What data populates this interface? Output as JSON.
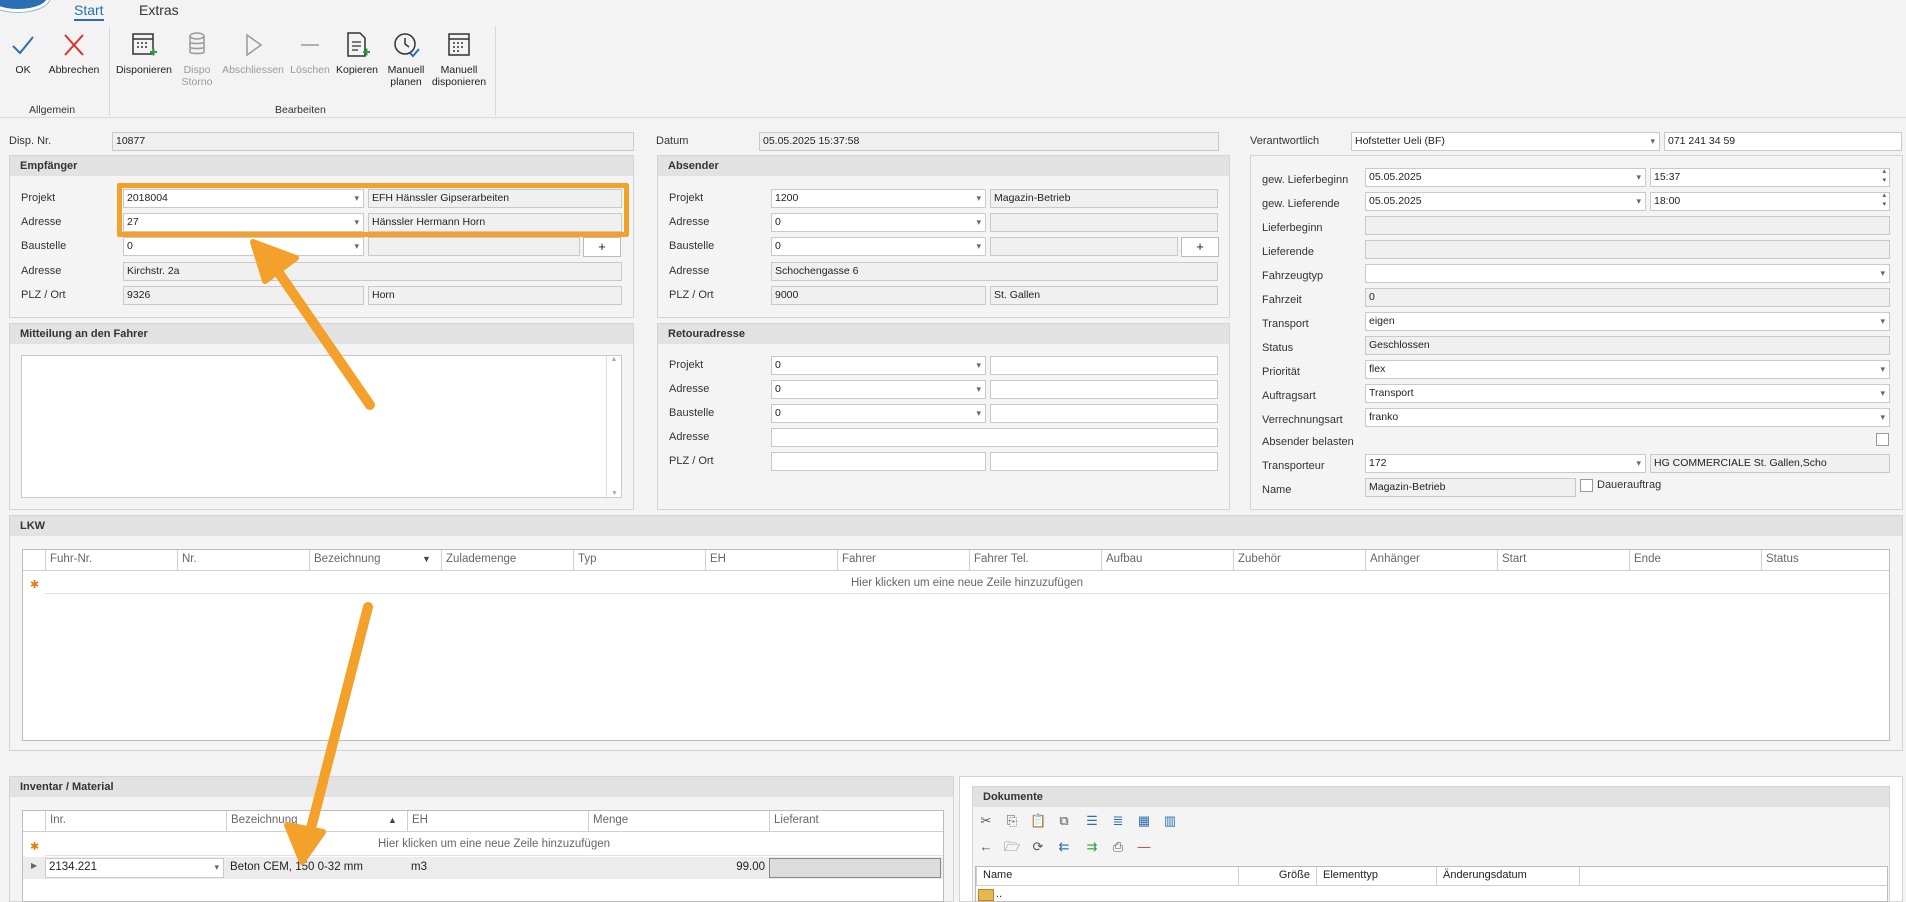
{
  "tabs": [
    "Start",
    "Extras"
  ],
  "ribbon": {
    "ok": "OK",
    "cancel": "Abbrechen",
    "group_general": "Allgemein",
    "disponieren": "Disponieren",
    "dispo_storno_1": "Dispo",
    "dispo_storno_2": "Storno",
    "abschliessen": "Abschliessen",
    "loeschen": "Löschen",
    "kopieren": "Kopieren",
    "manuell_planen_1": "Manuell",
    "manuell_planen_2": "planen",
    "manuell_disp_1": "Manuell",
    "manuell_disp_2": "disponieren",
    "group_edit": "Bearbeiten"
  },
  "header": {
    "disp_nr_label": "Disp. Nr.",
    "disp_nr": "10877",
    "datum_label": "Datum",
    "datum": "05.05.2025 15:37:58",
    "verantwortlich_label": "Verantwortlich",
    "verantwortlich": "Hofstetter Ueli (BF)",
    "phone": "071 241 34 59"
  },
  "empfaenger": {
    "title": "Empfänger",
    "projekt_label": "Projekt",
    "projekt": "2018004",
    "projekt_name": "EFH Hänssler Gipserarbeiten",
    "adresse_label": "Adresse",
    "adresse": "27",
    "adresse_name": "Hänssler Hermann Horn",
    "baustelle_label": "Baustelle",
    "baustelle": "0",
    "plus": "+",
    "strasse_label": "Adresse",
    "strasse": "Kirchstr. 2a",
    "plz_label": "PLZ / Ort",
    "plz": "9326",
    "ort": "Horn"
  },
  "absender": {
    "title": "Absender",
    "projekt_label": "Projekt",
    "projekt": "1200",
    "projekt_name": "Magazin-Betrieb",
    "adresse_label": "Adresse",
    "adresse": "0",
    "baustelle_label": "Baustelle",
    "baustelle": "0",
    "plus": "+",
    "strasse_label": "Adresse",
    "strasse": "Schochengasse 6",
    "plz_label": "PLZ / Ort",
    "plz": "9000",
    "ort": "St. Gallen"
  },
  "mitteilung": {
    "title": "Mitteilung an den Fahrer"
  },
  "retour": {
    "title": "Retouradresse",
    "projekt_label": "Projekt",
    "projekt": "0",
    "adresse_label": "Adresse",
    "adresse": "0",
    "baustelle_label": "Baustelle",
    "baustelle": "0",
    "strasse_label": "Adresse",
    "plz_label": "PLZ / Ort"
  },
  "right": {
    "lieferbeginn_label": "gew. Lieferbeginn",
    "lieferbeginn_date": "05.05.2025",
    "lieferbeginn_time": "15:37",
    "lieferende_label": "gew. Lieferende",
    "lieferende_date": "05.05.2025",
    "lieferende_time": "18:00",
    "lb_label": "Lieferbeginn",
    "le_label": "Lieferende",
    "fahrzeugtyp_label": "Fahrzeugtyp",
    "fahrzeit_label": "Fahrzeit",
    "fahrzeit": "0",
    "transport_label": "Transport",
    "transport": "eigen",
    "status_label": "Status",
    "status": "Geschlossen",
    "prioritaet_label": "Priorität",
    "prioritaet": "flex",
    "auftragsart_label": "Auftragsart",
    "auftragsart": "Transport",
    "verrechnung_label": "Verrechnungsart",
    "verrechnung": "franko",
    "absender_belasten_label": "Absender belasten",
    "transporteur_label": "Transporteur",
    "transporteur": "172",
    "transporteur_name": "HG COMMERCIALE St. Gallen,Scho",
    "name_label": "Name",
    "name": "Magazin-Betrieb",
    "dauerauftrag_label": "Dauerauftrag"
  },
  "lkw": {
    "title": "LKW",
    "columns": [
      "Fuhr-Nr.",
      "Nr.",
      "Bezeichnung",
      "Zulademenge",
      "Typ",
      "EH",
      "Fahrer",
      "Fahrer Tel.",
      "Aufbau",
      "Zubehör",
      "Anhänger",
      "Start",
      "Ende",
      "Status"
    ],
    "new_row": "Hier klicken um eine neue Zeile hinzuzufügen"
  },
  "inventar": {
    "title": "Inventar / Material",
    "columns": [
      "Inr.",
      "Bezeichnung",
      "EH",
      "Menge",
      "Lieferant"
    ],
    "new_row": "Hier klicken um eine neue Zeile hinzuzufügen",
    "row": {
      "inr": "2134.221",
      "bezeichnung": "Beton CEM, 150  0-32 mm",
      "eh": "m3",
      "menge": "99.00",
      "lieferant": ""
    }
  },
  "dokumente": {
    "title": "Dokumente",
    "columns": [
      "Name",
      "Größe",
      "Elementtyp",
      "Änderungsdatum"
    ],
    "first_row": ".."
  },
  "colors": {
    "accent": "#2a6fb3",
    "highlight": "#f3a12a",
    "cancel": "#d9302c"
  }
}
